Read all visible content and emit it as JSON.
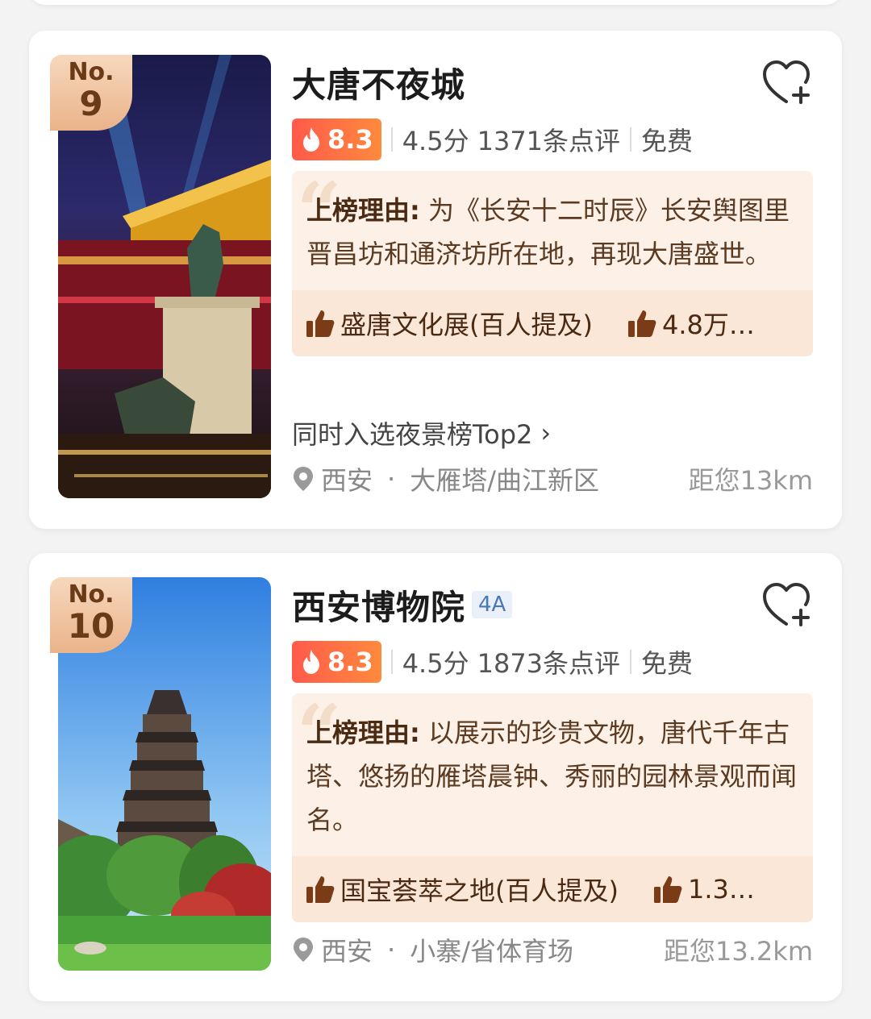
{
  "cards": [
    {
      "rank_no": "No.",
      "rank": "9",
      "name": "大唐不夜城",
      "level": "",
      "hot_score": "8.3",
      "rating": "4.5分",
      "reviews": "1371条点评",
      "price": "免费",
      "reason_label": "上榜理由:",
      "reason_text": "为《长安十二时辰》长安舆图里晋昌坊和通济坊所在地，再现大唐盛世。",
      "tag1": "盛唐文化展(百人提及)",
      "tag2": "4.8万…",
      "also_selected": "同时入选夜景榜Top2",
      "city": "西安",
      "area": "大雁塔/曲江新区",
      "distance": "距您13km"
    },
    {
      "rank_no": "No.",
      "rank": "10",
      "name": "西安博物院",
      "level": "4A",
      "hot_score": "8.3",
      "rating": "4.5分",
      "reviews": "1873条点评",
      "price": "免费",
      "reason_label": "上榜理由:",
      "reason_text": "以展示的珍贵文物，唐代千年古塔、悠扬的雁塔晨钟、秀丽的园林景观而闻名。",
      "tag1": "国宝荟萃之地(百人提及)",
      "tag2": "1.3…",
      "city": "西安",
      "area": "小寨/省体育场",
      "distance": "距您13.2km"
    }
  ],
  "separator_dot": "·",
  "icons": {
    "favorite": "heart-plus-icon",
    "hot": "flame-icon",
    "like": "thumbs-up-icon",
    "location": "map-pin-icon",
    "more": "chevron-right-icon"
  },
  "colors": {
    "hot_badge": "#ff6a45",
    "reason_bg": "#fdf0e6",
    "rank_badge": "#eab38a",
    "level_tag": "#4a78b7"
  }
}
